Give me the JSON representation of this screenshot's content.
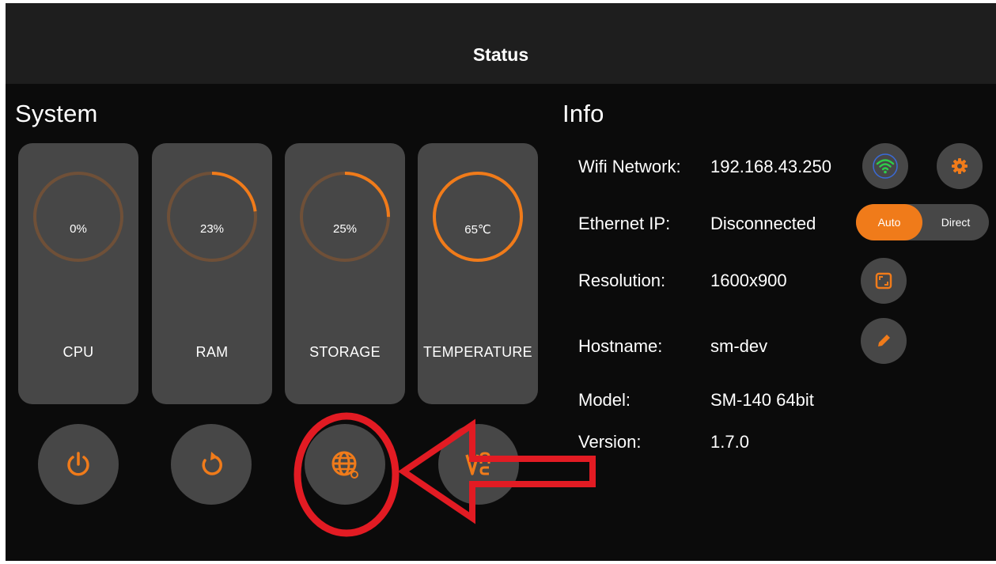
{
  "header": {
    "title": "Status"
  },
  "system": {
    "title": "System",
    "cards": [
      {
        "label": "CPU",
        "value": "0%",
        "percent": 0
      },
      {
        "label": "RAM",
        "value": "23%",
        "percent": 23
      },
      {
        "label": "STORAGE",
        "value": "25%",
        "percent": 25
      },
      {
        "label": "TEMPERATURE",
        "value": "65℃",
        "percent": 100
      }
    ],
    "buttons": [
      {
        "icon": "power-icon"
      },
      {
        "icon": "restart-icon"
      },
      {
        "icon": "globe-icon"
      },
      {
        "icon": "vnc-icon"
      }
    ]
  },
  "info": {
    "title": "Info",
    "rows": [
      {
        "label": "Wifi Network:",
        "value": "192.168.43.250"
      },
      {
        "label": "Ethernet IP:",
        "value": "Disconnected"
      },
      {
        "label": "Resolution:",
        "value": "1600x900"
      },
      {
        "label": "Hostname:",
        "value": "sm-dev"
      },
      {
        "label": "Model:",
        "value": "SM-140 64bit"
      },
      {
        "label": "Version:",
        "value": "1.7.0"
      }
    ],
    "ethernet_toggle": {
      "options": [
        "Auto",
        "Direct"
      ],
      "selected": "Auto"
    },
    "side_buttons": [
      "wifi-icon",
      "settings-icon",
      "resolution-icon",
      "edit-icon"
    ]
  },
  "colors": {
    "accent": "#f07b1a",
    "track": "#6f5038",
    "card": "#474747",
    "header": "#1e1e1e",
    "background": "#0b0b0b",
    "wifi": "#2ecc4a",
    "annotation": "#e21b23"
  }
}
